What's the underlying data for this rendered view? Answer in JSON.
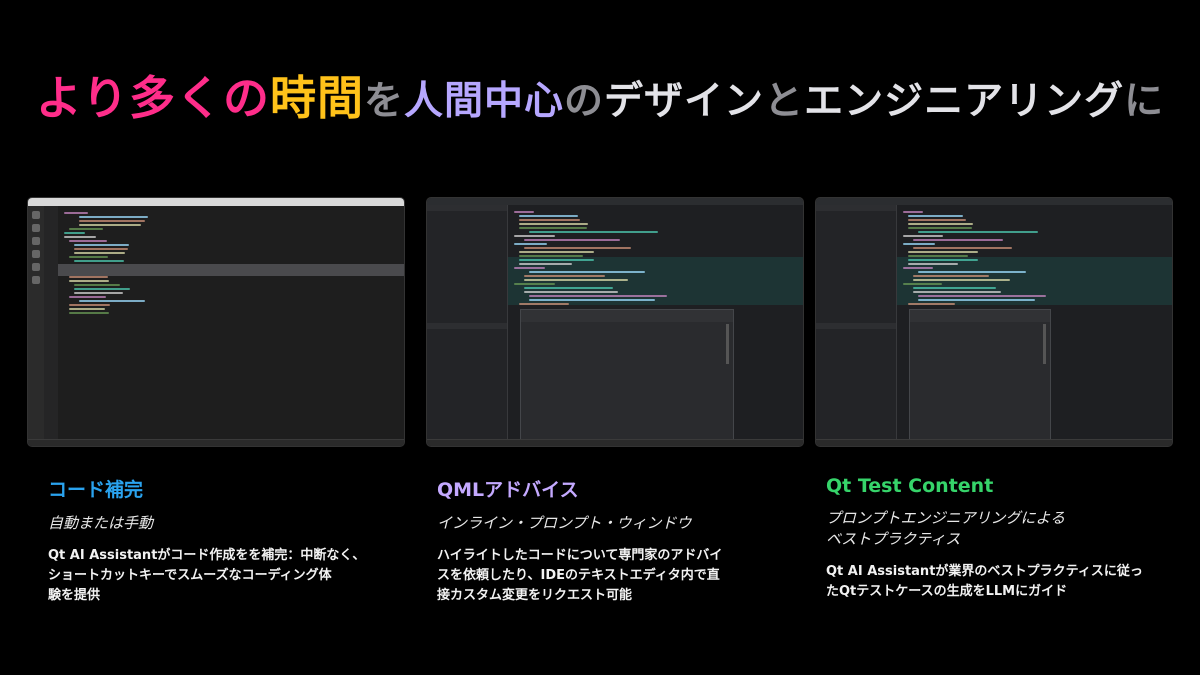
{
  "headline": {
    "part1": "より多くの",
    "part2": "時間",
    "part3": "を",
    "part4": "人間中心",
    "part5": "の",
    "part6": "デザイン",
    "part7": "と",
    "part8": "エンジニアリング",
    "part9": "に"
  },
  "colors": {
    "pink": "#ff2d8a",
    "yellow": "#ffc21a",
    "lavender": "#b6a7ff",
    "gray": "#8d8d93",
    "light": "#e3e3e8",
    "blue_title": "#2aa3ef",
    "purple_title": "#c4a9ff",
    "green_title": "#36d46a"
  },
  "features": [
    {
      "title": "コード補完",
      "subtitle": "自動または手動",
      "body": "Qt AI Assistantがコード作成をを補完：中断なく、\nショートカットキーでスムーズなコーディング体\n験を提供"
    },
    {
      "title": "QMLアドバイス",
      "subtitle": "インライン・プロンプト・ウィンドウ",
      "body": "ハイライトしたコードについて専門家のアドバイ\nスを依頼したり、IDEのテキストエディタ内で直\n接カスタム変更をリクエスト可能"
    },
    {
      "title": "Qt Test Content",
      "subtitle": "プロンプトエンジニアリングによる\nベストプラクティス",
      "body": "Qt AI Assistantが業界のベストプラクティスに従っ\nたQtテストケースの生成をLLMにガイド"
    }
  ]
}
